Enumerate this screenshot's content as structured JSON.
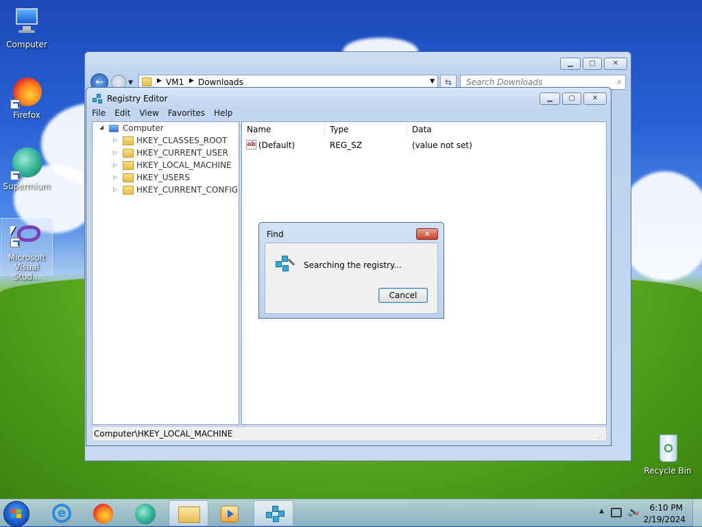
{
  "desktop": {
    "icons": [
      {
        "label": "Computer"
      },
      {
        "label": "Firefox"
      },
      {
        "label": "Supermium"
      },
      {
        "label": "Microsoft Visual Stud..."
      },
      {
        "label": "Recycle Bin"
      }
    ]
  },
  "explorer": {
    "address_parts": [
      "VM1",
      "Downloads"
    ],
    "search_placeholder": "Search Downloads"
  },
  "regedit": {
    "title": "Registry Editor",
    "menu": [
      "File",
      "Edit",
      "View",
      "Favorites",
      "Help"
    ],
    "tree": {
      "root": "Computer",
      "children": [
        "HKEY_CLASSES_ROOT",
        "HKEY_CURRENT_USER",
        "HKEY_LOCAL_MACHINE",
        "HKEY_USERS",
        "HKEY_CURRENT_CONFIG"
      ]
    },
    "columns": [
      "Name",
      "Type",
      "Data"
    ],
    "rows": [
      {
        "name": "(Default)",
        "type": "REG_SZ",
        "data": "(value not set)",
        "icon": "ab"
      }
    ],
    "status": "Computer\\HKEY_LOCAL_MACHINE"
  },
  "find_dialog": {
    "title": "Find",
    "message": "Searching the registry...",
    "cancel_label": "Cancel"
  },
  "taskbar": {
    "time": "6:10 PM",
    "date": "2/19/2024"
  }
}
